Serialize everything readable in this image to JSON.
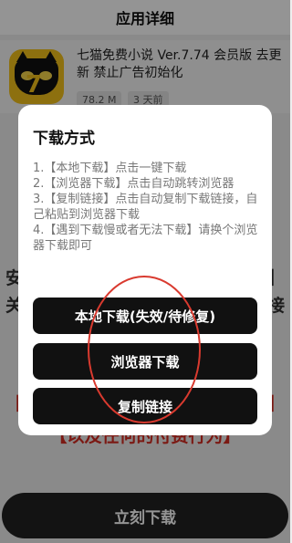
{
  "header": {
    "title": "应用详细"
  },
  "app": {
    "name": "七猫免费小说 Ver.7.74 会员版 去更新 禁止广告初始化",
    "size": "78.2 M",
    "date": "3 天前",
    "icon": "seven-cat-app-icon"
  },
  "background_lines": {
    "line_a": "安",
    "line_a_right": "】",
    "line_b": "关",
    "line_b_right": "接",
    "line_c": "【",
    "line_c_right": "】",
    "line_d": "【以及任何的付费行为】"
  },
  "dialog": {
    "title": "下载方式",
    "steps": [
      "1.【本地下载】点击一键下载",
      "2.【浏览器下载】点击自动跳转浏览器",
      "3.【复制链接】点击自动复制下载链接，自己粘贴到浏览器下载",
      "4.【遇到下载慢或者无法下载】请换个浏览器下载即可"
    ],
    "buttons": {
      "local": "本地下载(失效/待修复)",
      "browser": "浏览器下载",
      "copy": "复制链接"
    }
  },
  "bottom_button": "立刻下载",
  "colors": {
    "accent_red": "#d52b22",
    "button_black": "#111111"
  }
}
